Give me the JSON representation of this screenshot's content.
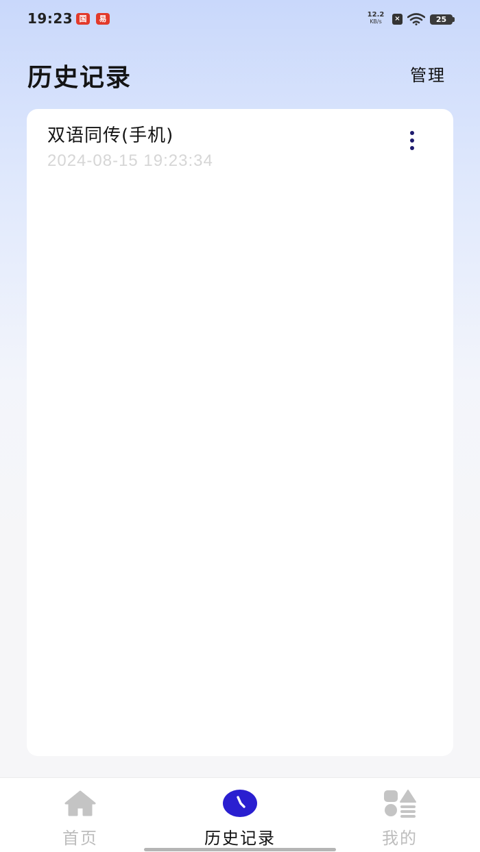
{
  "status_bar": {
    "time": "19:23",
    "app_icons": [
      "国",
      "易"
    ],
    "net_speed": "12.2",
    "net_speed_unit": "KB/s",
    "no_sim_symbol": "×",
    "battery": "25",
    "icons": [
      "app-icon",
      "app-icon",
      "no-sim-icon",
      "wifi-icon",
      "battery-icon"
    ]
  },
  "header": {
    "title": "历史记录",
    "manage_label": "管理"
  },
  "records": [
    {
      "title": "双语同传(手机)",
      "timestamp": "2024-08-15 19:23:34",
      "menu_icon": "more-vertical-icon"
    }
  ],
  "bottom_nav": {
    "items": [
      {
        "label": "首页",
        "icon": "home-icon",
        "active": false
      },
      {
        "label": "历史记录",
        "icon": "clock-icon",
        "active": true
      },
      {
        "label": "我的",
        "icon": "profile-grid-icon",
        "active": false
      }
    ]
  },
  "colors": {
    "accent": "#2a1fd0",
    "inactive": "#bdbdbd",
    "timestamp": "#d6d6d6",
    "menu_dots": "#1e1b6e"
  }
}
